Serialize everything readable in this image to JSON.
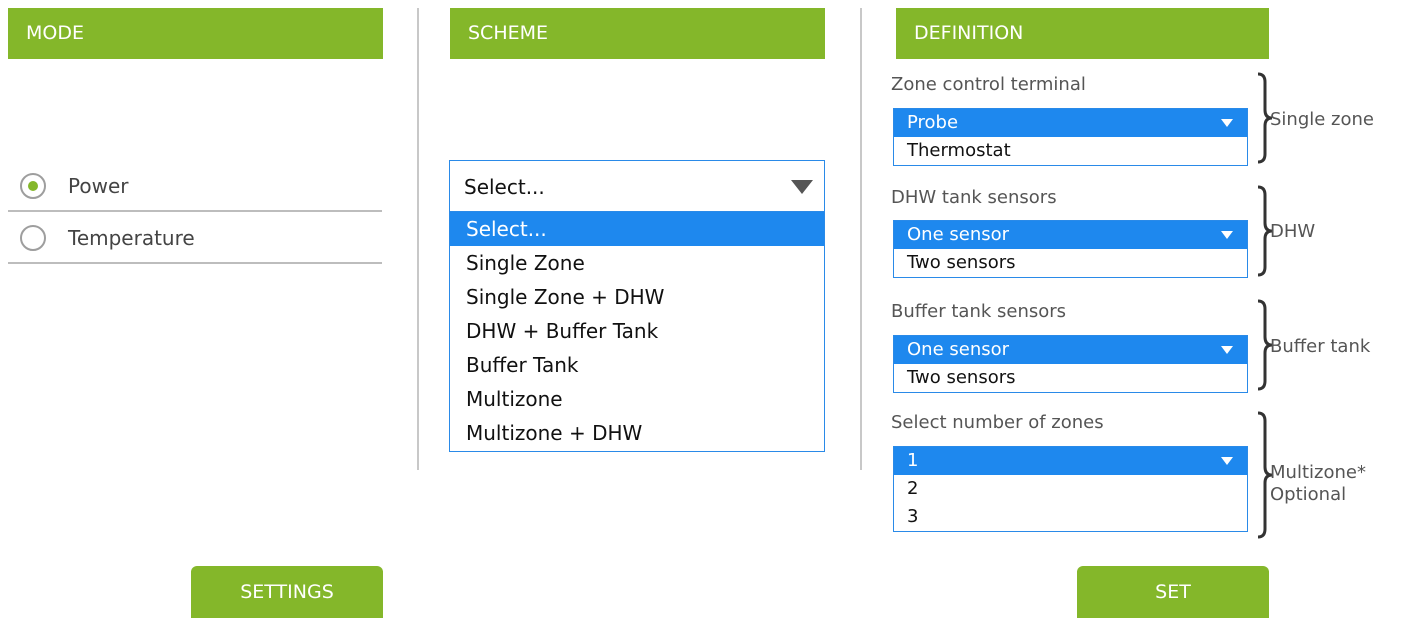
{
  "mode": {
    "header": "MODE",
    "options": [
      {
        "label": "Power",
        "selected": true
      },
      {
        "label": "Temperature",
        "selected": false
      }
    ]
  },
  "scheme": {
    "header": "SCHEME",
    "current_value": "Select...",
    "options": [
      "Select...",
      "Single Zone",
      "Single Zone + DHW",
      "DHW + Buffer Tank",
      "Buffer Tank",
      "Multizone",
      "Multizone + DHW"
    ]
  },
  "definition": {
    "header": "DEFINITION",
    "groups": [
      {
        "label": "Zone control terminal",
        "options": [
          "Probe",
          "Thermostat"
        ],
        "group_name": "Single zone"
      },
      {
        "label": "DHW tank sensors",
        "options": [
          "One sensor",
          "Two sensors"
        ],
        "group_name": "DHW"
      },
      {
        "label": "Buffer tank sensors",
        "options": [
          "One sensor",
          "Two sensors"
        ],
        "group_name": "Buffer tank"
      },
      {
        "label": "Select number of zones",
        "options": [
          "1",
          "2",
          "3"
        ],
        "group_name": "Multizone*",
        "group_note": "Optional"
      }
    ]
  },
  "buttons": {
    "settings": "SETTINGS",
    "set": "SET"
  },
  "colors": {
    "accent": "#84b72a",
    "selection": "#1e88ee",
    "border": "#2a8ae8"
  }
}
